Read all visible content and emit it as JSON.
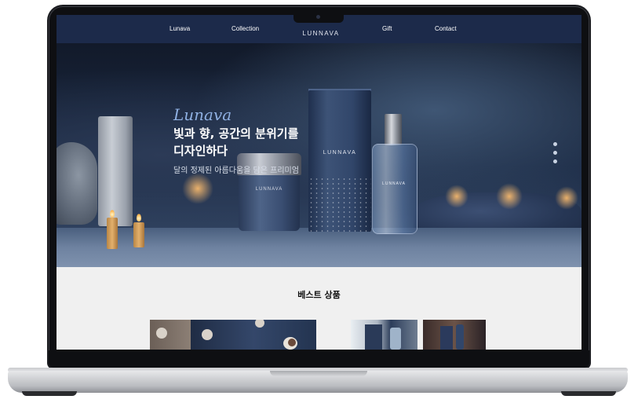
{
  "nav": {
    "items": [
      "Lunava",
      "Collection",
      "Gift",
      "Contact"
    ],
    "brand": "LUNNAVA"
  },
  "hero": {
    "brand": "Lunava",
    "title_line1": "빛과 향, 공간의 분위기를",
    "title_line2": "디자인하다",
    "subtitle": "달의 정제된 아름다움을 담은 프리미엄",
    "product_label": "LUNNAVA",
    "slide_count": 3
  },
  "best": {
    "title": "베스트 상품"
  },
  "colors": {
    "nav_bg": "#1c2a4a",
    "brand_accent": "#8fb0e2",
    "section_bg": "#f0f0f0"
  },
  "icons": [
    "moon-logo-icon",
    "slide-dot-icon"
  ]
}
